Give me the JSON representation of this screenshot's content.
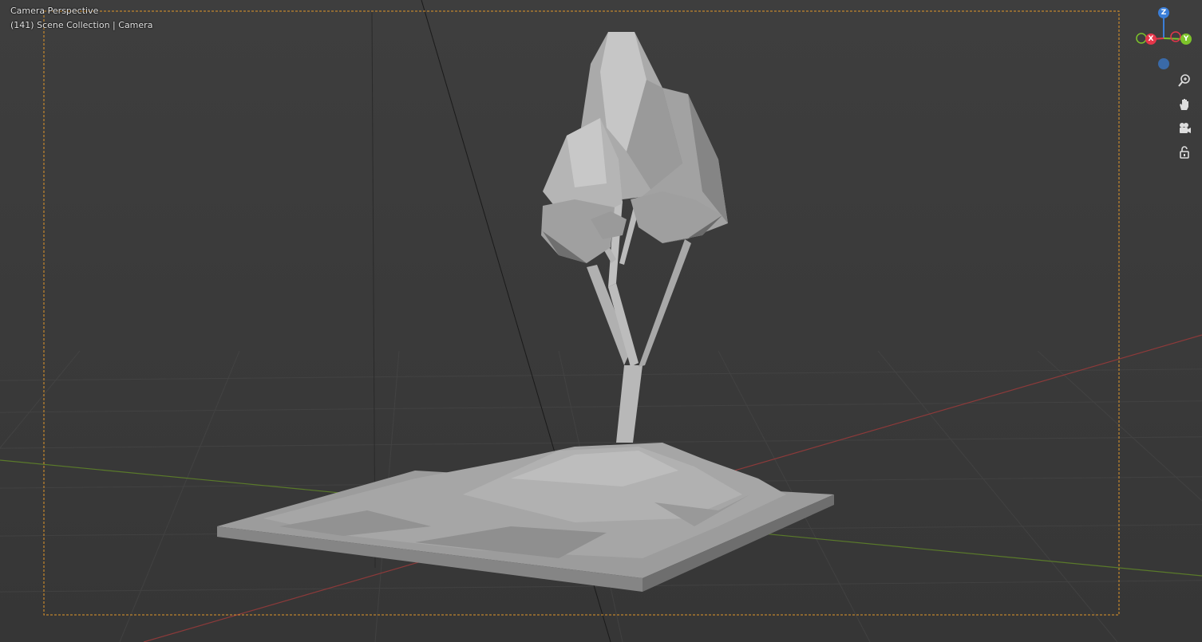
{
  "viewport": {
    "title": "Camera Perspective",
    "frame": "(141)",
    "collection": "Scene Collection",
    "object": "Camera"
  },
  "gizmo": {
    "axes": [
      {
        "label": "X",
        "color": "#e5364a"
      },
      {
        "label": "Y",
        "color": "#7dc42a"
      },
      {
        "label": "Z",
        "color": "#3a7ed8"
      }
    ]
  },
  "nav_buttons": [
    {
      "name": "zoom-icon"
    },
    {
      "name": "hand-pan-icon"
    },
    {
      "name": "camera-view-icon"
    },
    {
      "name": "lock-icon"
    }
  ],
  "colors": {
    "background": "#3c3c3c",
    "camera_frame": "#e0962a",
    "x_axis_line": "#8c3a3a",
    "y_axis_line": "#5a7a2a",
    "model": "#a9a9a9"
  }
}
